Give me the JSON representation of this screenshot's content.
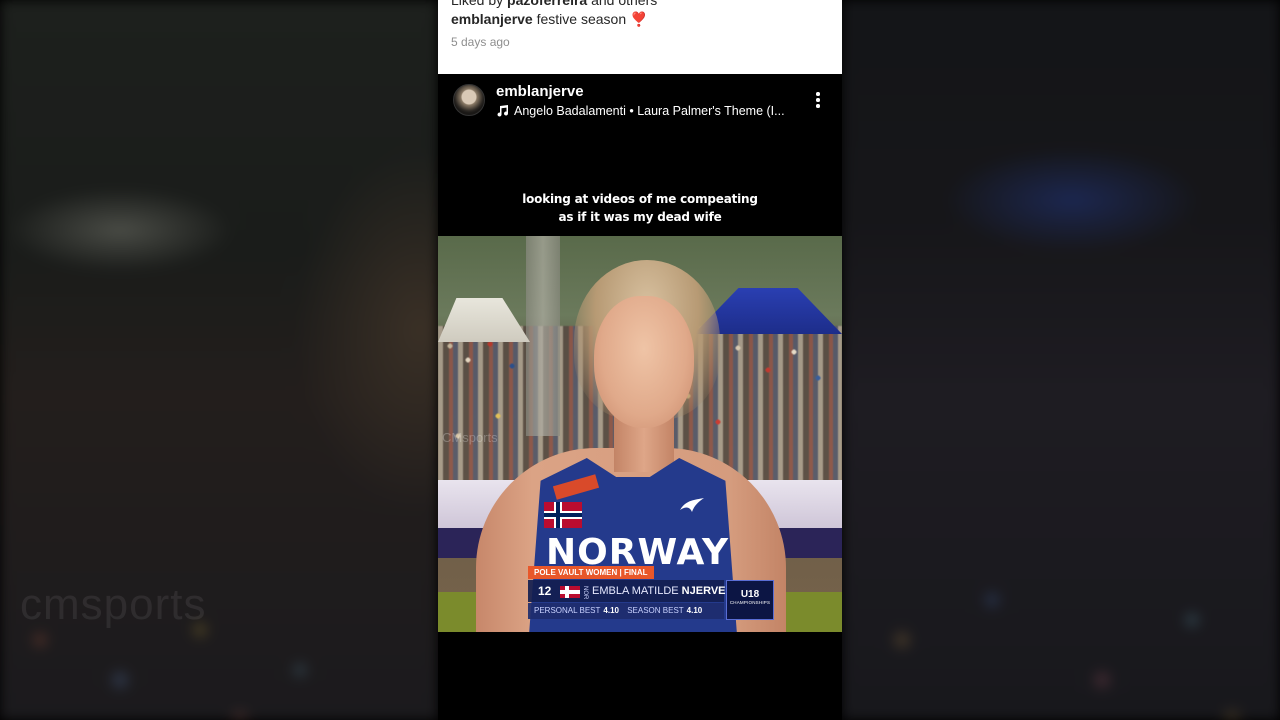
{
  "previous_post": {
    "liked_by_prefix": "Liked by",
    "liked_by_user": "pazoferreira",
    "liked_by_suffix": "and others",
    "caption_user": "emblanjerve",
    "caption_text": "festive season",
    "caption_emoji": "❣️",
    "time_ago": "5 days ago"
  },
  "post": {
    "username": "emblanjerve",
    "music": "Angelo Badalamenti • Laura Palmer's Theme (I...",
    "overlay_text_line1": "looking at videos of me compeating",
    "overlay_text_line2": "as if it was my dead wife",
    "video_watermark": "CMsports"
  },
  "video_graphics": {
    "singlet_text": "NORWAY",
    "event_label": "POLE VAULT WOMEN | FINAL",
    "bib": "12",
    "country_code": "NOR",
    "athlete_first": "EMBLA MATILDE",
    "athlete_last": "NJERVE",
    "personal_best_label": "PERSONAL BEST",
    "personal_best": "4.10",
    "season_best_label": "SEASON BEST",
    "season_best": "4.10",
    "championship_logo": "U18",
    "championship_sub": "CHAMPIONSHIPS"
  },
  "backdrop": {
    "watermark": "cmsports"
  },
  "colors": {
    "accent_heart": "#ed4956",
    "singlet_blue": "#243a8c",
    "event_orange": "#e8572a"
  }
}
